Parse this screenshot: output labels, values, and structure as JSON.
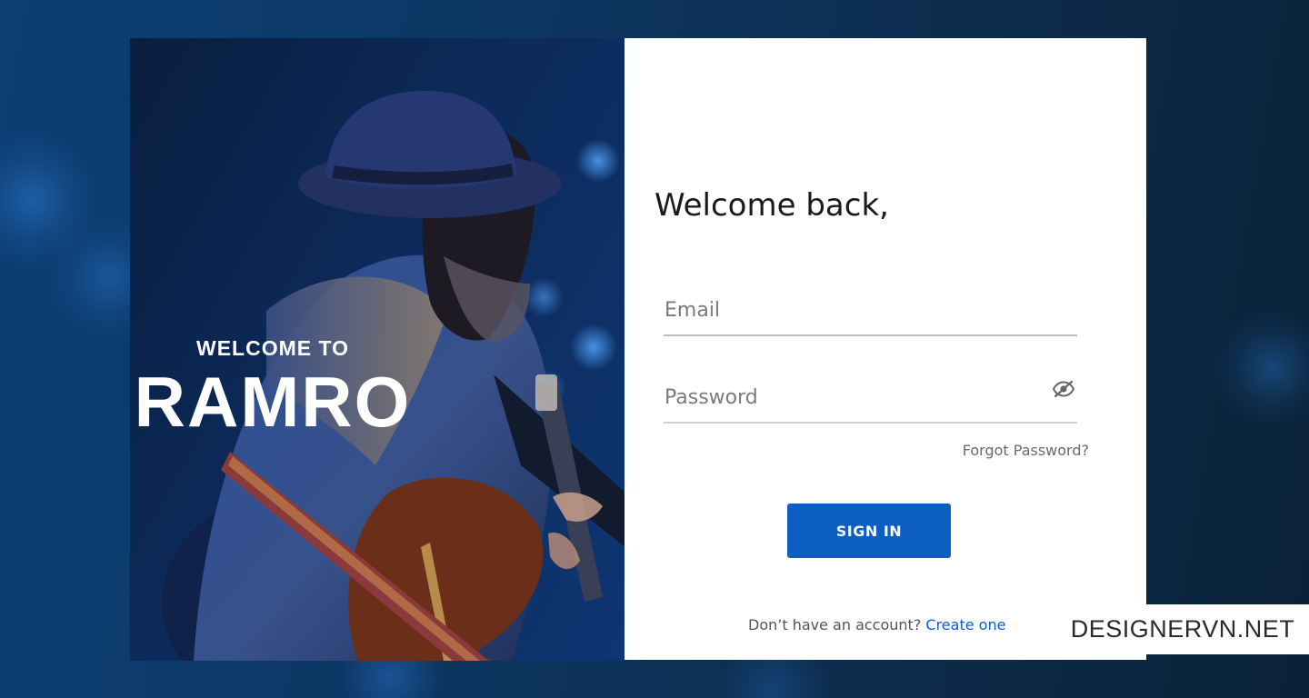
{
  "hero": {
    "welcome_to": "WELCOME TO",
    "brand": "RAMRO"
  },
  "login": {
    "heading": "Welcome back,",
    "email_placeholder": "Email",
    "email_value": "",
    "password_placeholder": "Password",
    "password_value": "",
    "password_toggle_icon": "eye-slash-icon",
    "forgot_password": "Forgot Password?",
    "sign_in": "SIGN IN",
    "no_account_text": "Don’t have an account?",
    "create_account": "Create one"
  },
  "watermark": "DESIGNERVN.NET",
  "colors": {
    "accent": "#0c5fc0",
    "background": "#0d2f52",
    "card": "#ffffff"
  }
}
